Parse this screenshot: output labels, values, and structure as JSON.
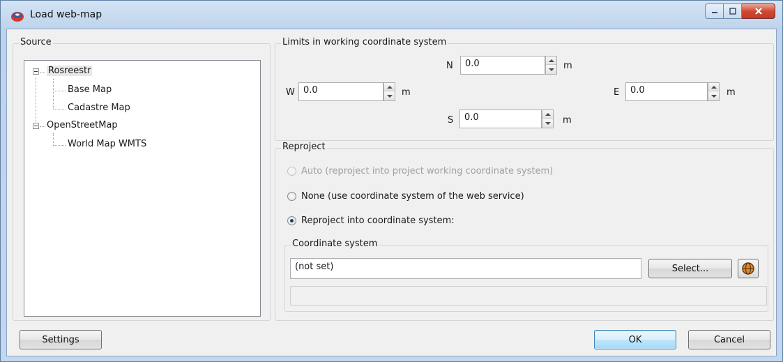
{
  "window": {
    "title": "Load web-map",
    "icons": {
      "app": "web-map-app-icon",
      "minimize": "minimize-icon",
      "maximize": "maximize-icon",
      "close": "close-icon"
    },
    "colors": {
      "close_button": "#c9432d",
      "default_button_border": "#3c7fb1"
    }
  },
  "source": {
    "group_title": "Source",
    "tree": [
      {
        "label": "Rosreestr",
        "expanded": true,
        "selected": true,
        "children": [
          {
            "label": "Base Map"
          },
          {
            "label": "Cadastre Map"
          }
        ]
      },
      {
        "label": "OpenStreetMap",
        "expanded": true,
        "children": [
          {
            "label": "World Map WMTS"
          }
        ]
      }
    ]
  },
  "limits": {
    "group_title": "Limits in working coordinate system",
    "north": {
      "label": "N",
      "value": "0.0",
      "unit": "m"
    },
    "west": {
      "label": "W",
      "value": "0.0",
      "unit": "m"
    },
    "east": {
      "label": "E",
      "value": "0.0",
      "unit": "m"
    },
    "south": {
      "label": "S",
      "value": "0.0",
      "unit": "m"
    }
  },
  "reproject": {
    "group_title": "Reproject",
    "options": [
      {
        "label": "Auto (reproject into project working coordinate system)",
        "checked": false,
        "enabled": false
      },
      {
        "label": "None (use coordinate system of the web service)",
        "checked": false,
        "enabled": true
      },
      {
        "label": "Reproject into coordinate system:",
        "checked": true,
        "enabled": true
      }
    ],
    "coordinate_system": {
      "group_title": "Coordinate system",
      "value": "(not set)",
      "select_label": "Select...",
      "globe_icon": "globe-icon"
    }
  },
  "footer": {
    "settings_label": "Settings",
    "ok_label": "OK",
    "cancel_label": "Cancel"
  }
}
